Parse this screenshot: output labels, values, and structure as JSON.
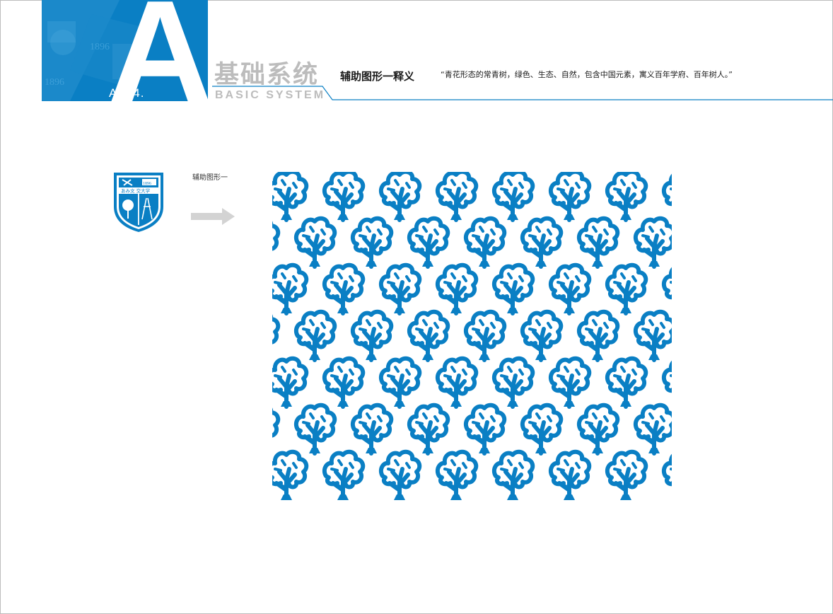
{
  "header": {
    "big_letter": "A",
    "page_number": "A. 14.",
    "system_title_cn": "基础系统",
    "system_title_en": "BASIC SYSTEM",
    "deco_year": "1896"
  },
  "section": {
    "title": "辅助图形一释义",
    "description": "“青花形态的常青树，绿色、生态、自然，包含中国元素，寓义百年学府、百年树人。”"
  },
  "figure": {
    "label": "辅助图形一",
    "emblem_year": "1896"
  },
  "colors": {
    "brand_blue": "#0a7fc4",
    "gray_text": "#bcbcbc",
    "arrow_gray": "#d3d3d3"
  },
  "icons": [
    "university-emblem-icon",
    "arrow-right-icon",
    "tree-pattern-icon"
  ]
}
